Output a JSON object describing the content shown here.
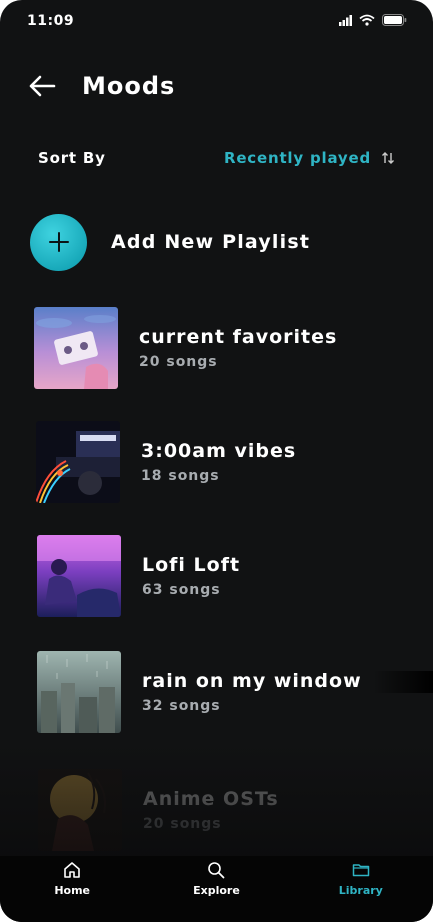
{
  "status": {
    "time": "11:09"
  },
  "header": {
    "title": "Moods",
    "back_icon": "arrow-left-icon"
  },
  "sort": {
    "label": "Sort By",
    "value": "Recently played",
    "icon": "sort-arrows-icon"
  },
  "add_playlist": {
    "label": "Add New Playlist",
    "icon": "plus-icon"
  },
  "playlists": [
    {
      "title": "current favorites",
      "subtitle": "20 songs"
    },
    {
      "title": "3:00am vibes",
      "subtitle": "18 songs"
    },
    {
      "title": "Lofi Loft",
      "subtitle": "63 songs"
    },
    {
      "title": "rain on my window",
      "subtitle": "32 songs"
    },
    {
      "title": "Anime OSTs",
      "subtitle": "20 songs"
    }
  ],
  "nav": [
    {
      "label": "Home",
      "icon": "home-icon"
    },
    {
      "label": "Explore",
      "icon": "search-icon"
    },
    {
      "label": "Library",
      "icon": "folder-icon",
      "active": true
    }
  ],
  "colors": {
    "accent": "#2fb4c4",
    "background": "#111213"
  }
}
